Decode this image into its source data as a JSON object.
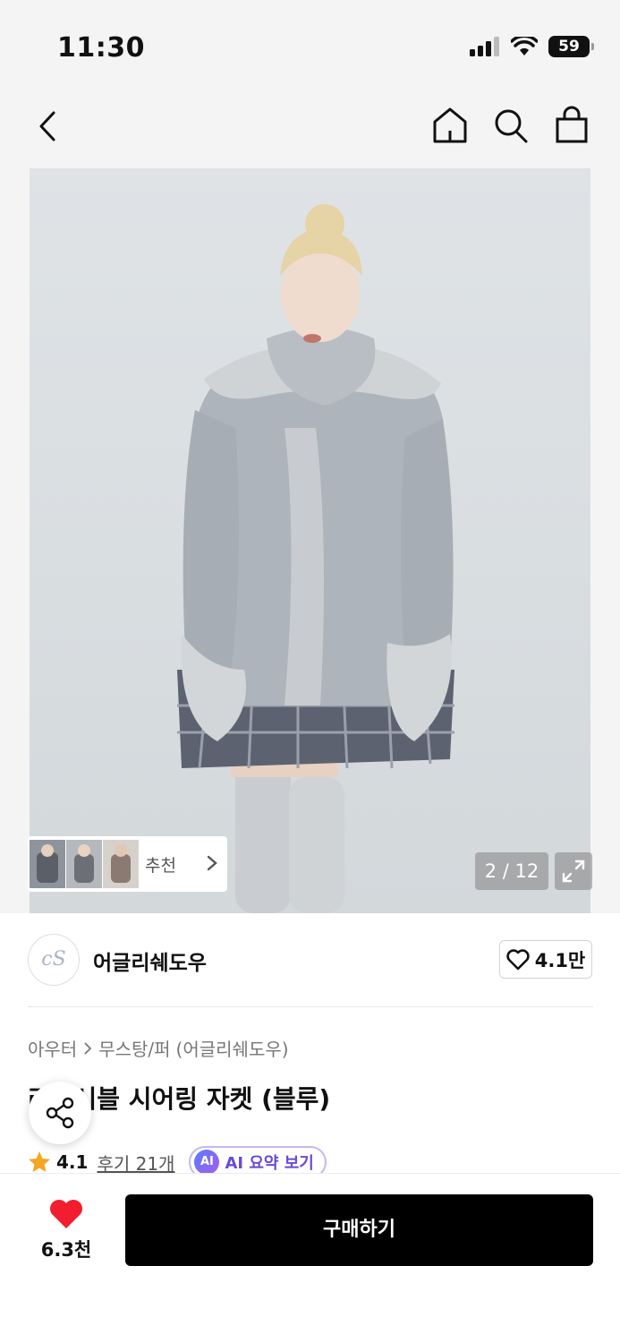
{
  "status_bar": {
    "time": "11:30",
    "battery": "59"
  },
  "nav": {
    "back_icon": "chevron-left-icon",
    "home_icon": "home-icon",
    "search_icon": "search-icon",
    "bag_icon": "shopping-bag-icon"
  },
  "gallery": {
    "pager": "2 / 12",
    "recommend_label": "추천",
    "expand_icon": "expand-icon"
  },
  "brand": {
    "logo_text": "cS",
    "name": "어글리쉐도우",
    "like_count": "4.1만"
  },
  "product": {
    "breadcrumb": [
      "아우터",
      "무스탕/퍼",
      "(어글리쉐도우)"
    ],
    "title": "리버시블 시어링 자켓 (블루)",
    "rating": "4.1",
    "reviews": "후기 21개",
    "ai_badge": "AI",
    "ai_summary": "AI 요약 보기"
  },
  "bottom": {
    "favorite_count": "6.3천",
    "buy_label": "구매하기"
  },
  "colors": {
    "accent_red": "#f21d2f",
    "star": "#f5a623",
    "ai_purple": "#6b4ad6",
    "buy_bg": "#000000"
  }
}
